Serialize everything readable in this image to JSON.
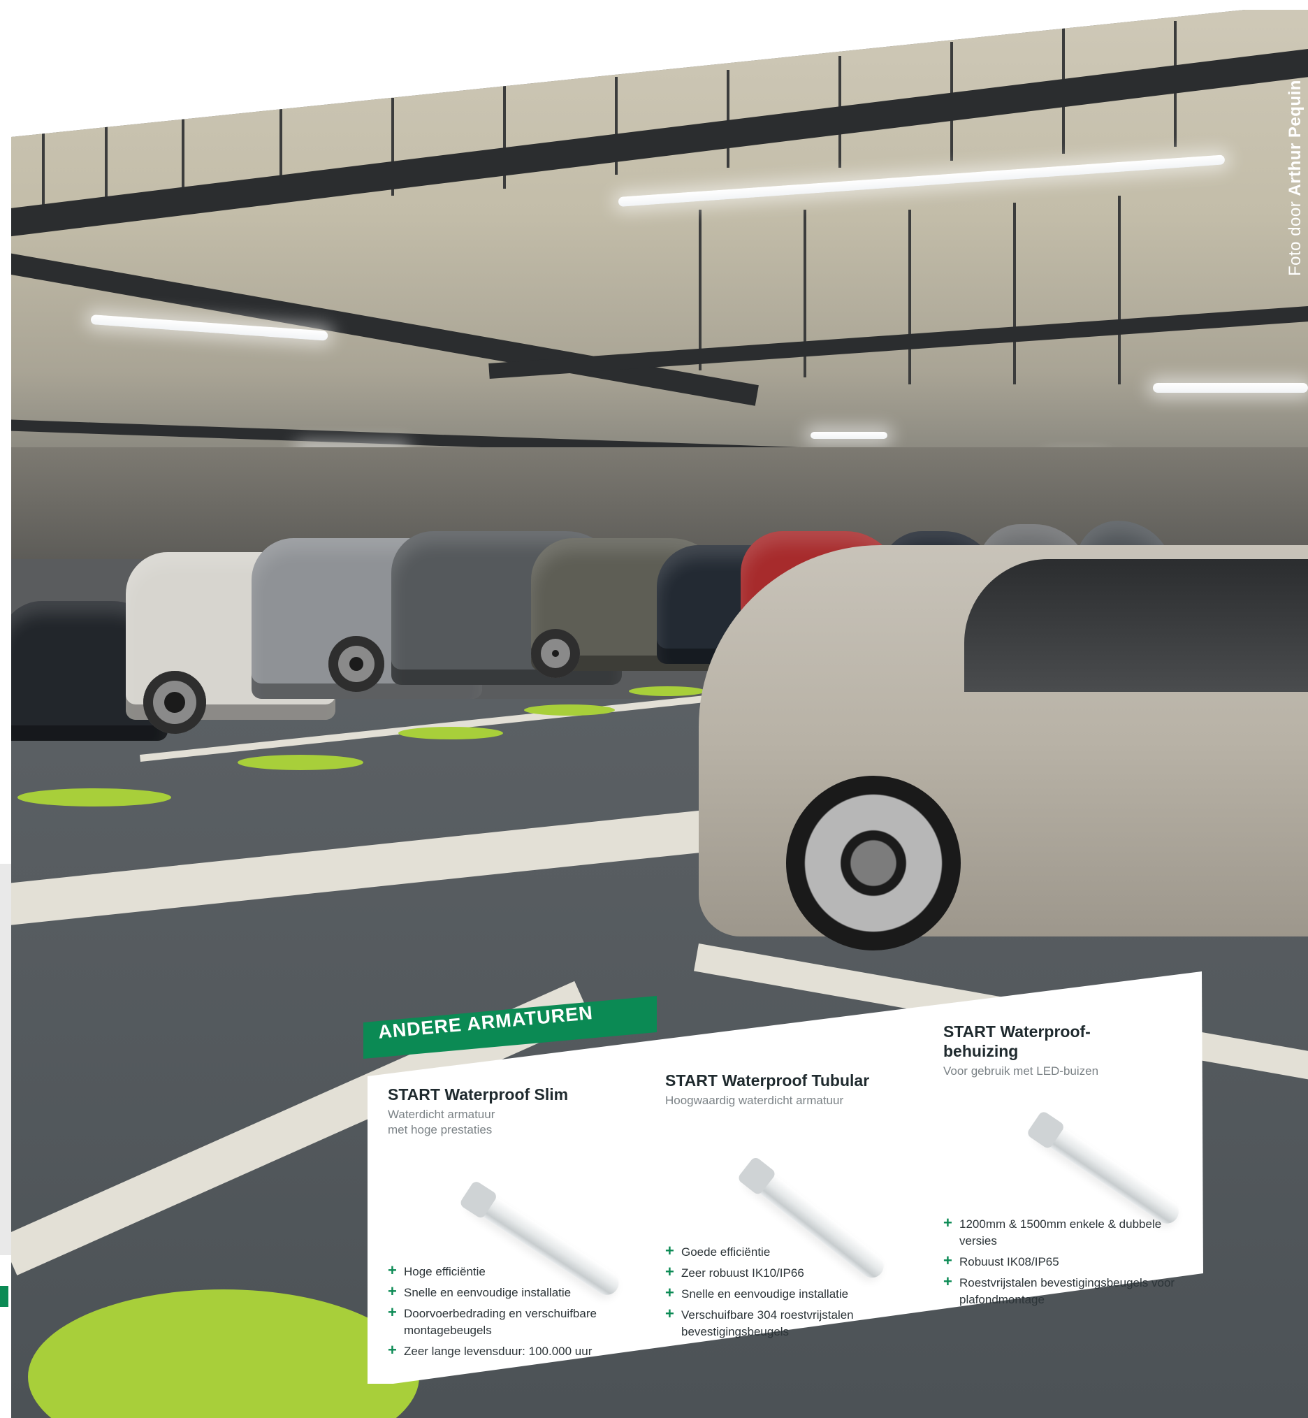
{
  "credit": {
    "prefix": "Foto door",
    "name": "Arthur Pequin"
  },
  "section": {
    "title": "ANDERE ARMATUREN"
  },
  "products": [
    {
      "name": "START Waterproof Slim",
      "subtitle_lines": [
        "Waterdicht armatuur",
        "met hoge prestaties"
      ],
      "features": [
        "Hoge efficiëntie",
        "Snelle en eenvoudige installatie",
        "Doorvoerbedrading en verschuifbare montagebeugels",
        "Zeer lange levensduur: 100.000 uur"
      ]
    },
    {
      "name": "START Waterproof Tubular",
      "subtitle_lines": [
        "Hoogwaardig waterdicht armatuur"
      ],
      "features": [
        "Goede efficiëntie",
        "Zeer robuust IK10/IP66",
        "Snelle en eenvoudige installatie",
        "Verschuifbare 304 roestvrijstalen bevestigingsbeugels"
      ]
    },
    {
      "name_lines": [
        "START Waterproof-",
        "behuizing"
      ],
      "subtitle_lines": [
        "Voor gebruik met LED-buizen"
      ],
      "features": [
        "1200mm & 1500mm enkele & dubbele versies",
        "Robuust IK08/IP65",
        "Roestvrijstalen bevestigingsbeugels voor plafondmontage"
      ]
    }
  ],
  "colors": {
    "brand_green": "#0b8a54",
    "floor_spot_green": "#a8cf3a",
    "plus_green": "#0b8a54"
  }
}
